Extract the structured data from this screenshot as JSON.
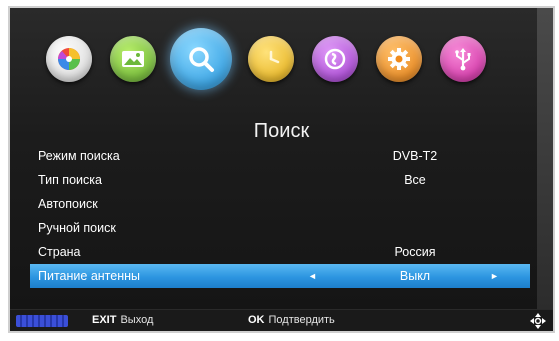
{
  "screen_title": "Поиск",
  "icons": [
    {
      "name": "picture-icon",
      "color": "#e8e8e8"
    },
    {
      "name": "image-icon",
      "color": "#7ec43a"
    },
    {
      "name": "search-icon",
      "color": "#1fa3e8",
      "active": true
    },
    {
      "name": "clock-icon",
      "color": "#f0c21a"
    },
    {
      "name": "globe-icon",
      "color": "#b04cd8"
    },
    {
      "name": "gear-icon",
      "color": "#f08a1a"
    },
    {
      "name": "usb-icon",
      "color": "#d83ab0"
    }
  ],
  "menu": {
    "items": [
      {
        "label": "Режим поиска",
        "value": "DVB-T2"
      },
      {
        "label": "Тип поиска",
        "value": "Все"
      },
      {
        "label": "Автопоиск",
        "value": ""
      },
      {
        "label": "Ручной поиск",
        "value": ""
      },
      {
        "label": "Страна",
        "value": "Россия"
      },
      {
        "label": "Питание антенны",
        "value": "Выкл",
        "selected": true
      }
    ]
  },
  "arrows": {
    "left": "◄",
    "right": "►"
  },
  "footer": {
    "exit_key": "EXIT",
    "exit_label": "Выход",
    "ok_key": "OK",
    "ok_label": "Подтвердить"
  },
  "colors": {
    "selection": "#2c95e0",
    "background": "#1c1c1c"
  }
}
